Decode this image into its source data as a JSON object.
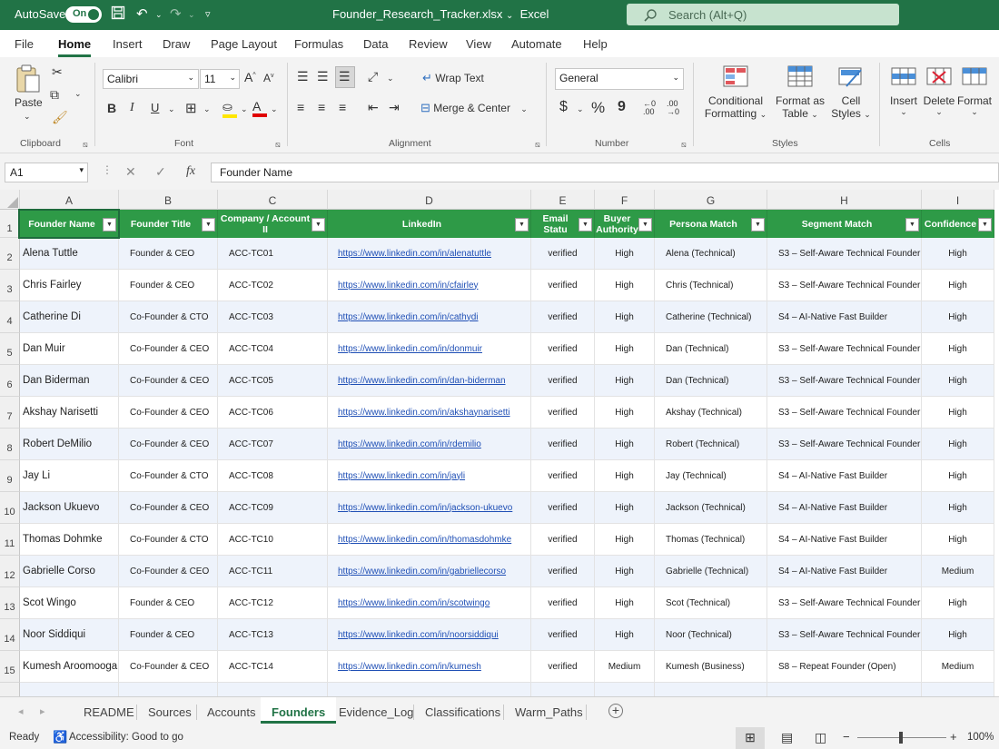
{
  "titlebar": {
    "autosave_label": "AutoSave",
    "autosave_state": "On",
    "doc_title": "Founder_Research_Tracker.xlsx",
    "app_name": "Excel",
    "search_placeholder": "Search (Alt+Q)",
    "color": "#217346"
  },
  "menu": [
    "File",
    "Home",
    "Insert",
    "Draw",
    "Page Layout",
    "Formulas",
    "Data",
    "Review",
    "View",
    "Automate",
    "Help"
  ],
  "ribbon": {
    "clipboard": {
      "paste": "Paste",
      "label": "Clipboard"
    },
    "font": {
      "name": "Calibri",
      "size": "11",
      "label": "Font",
      "bold": "B",
      "italic": "I",
      "underline": "U"
    },
    "alignment": {
      "wrap": "Wrap Text",
      "merge": "Merge & Center",
      "label": "Alignment"
    },
    "number": {
      "format": "General",
      "currency": "$",
      "percent": "%",
      "comma": "9",
      "label": "Number"
    },
    "styles": {
      "cond1": "Conditional",
      "cond2": "Formatting",
      "fmt1": "Format as",
      "fmt2": "Table",
      "cell1": "Cell",
      "cell2": "Styles",
      "label": "Styles"
    },
    "cells": {
      "insert": "Insert",
      "delete": "Delete",
      "format": "Format",
      "label": "Cells"
    }
  },
  "formula_bar": {
    "name_box": "A1",
    "fx": "fx",
    "content": "Founder Name"
  },
  "columns": [
    "A",
    "B",
    "C",
    "D",
    "E",
    "F",
    "G",
    "H",
    "I"
  ],
  "headers": [
    "Founder Name",
    "Founder Title",
    "Company / Account ID",
    "LinkedIn",
    "Email Status",
    "Buyer Authority",
    "Persona Match",
    "Segment Match",
    "Confidence"
  ],
  "header_display": [
    "Founder Name",
    "Founder Title",
    "Company / Account II",
    "LinkedIn",
    "Email Statu",
    "Buyer Authority",
    "Persona Match",
    "Segment Match",
    "Confidence"
  ],
  "rows": [
    {
      "n": "2",
      "name": "Alena Tuttle",
      "title": "Founder & CEO",
      "acc": "ACC-TC01",
      "li": "https://www.linkedin.com/in/alenatuttle",
      "email": "verified",
      "auth": "High",
      "persona": "Alena (Technical)",
      "segment": "S3 – Self-Aware Technical Founder",
      "conf": "High"
    },
    {
      "n": "3",
      "name": "Chris Fairley",
      "title": "Founder & CEO",
      "acc": "ACC-TC02",
      "li": "https://www.linkedin.com/in/cfairley",
      "email": "verified",
      "auth": "High",
      "persona": "Chris (Technical)",
      "segment": "S3 – Self-Aware Technical Founder",
      "conf": "High"
    },
    {
      "n": "4",
      "name": "Catherine Di",
      "title": "Co-Founder & CTO",
      "acc": "ACC-TC03",
      "li": "https://www.linkedin.com/in/cathydi",
      "email": "verified",
      "auth": "High",
      "persona": "Catherine (Technical)",
      "segment": "S4 – AI-Native Fast Builder",
      "conf": "High"
    },
    {
      "n": "5",
      "name": "Dan Muir",
      "title": "Co-Founder & CEO",
      "acc": "ACC-TC04",
      "li": "https://www.linkedin.com/in/donmuir",
      "email": "verified",
      "auth": "High",
      "persona": "Dan (Technical)",
      "segment": "S3 – Self-Aware Technical Founder",
      "conf": "High"
    },
    {
      "n": "6",
      "name": "Dan Biderman",
      "title": "Co-Founder & CEO",
      "acc": "ACC-TC05",
      "li": "https://www.linkedin.com/in/dan-biderman",
      "email": "verified",
      "auth": "High",
      "persona": "Dan (Technical)",
      "segment": "S3 – Self-Aware Technical Founder",
      "conf": "High"
    },
    {
      "n": "7",
      "name": "Akshay Narisetti",
      "title": "Co-Founder & CEO",
      "acc": "ACC-TC06",
      "li": "https://www.linkedin.com/in/akshaynarisetti",
      "email": "verified",
      "auth": "High",
      "persona": "Akshay (Technical)",
      "segment": "S3 – Self-Aware Technical Founder",
      "conf": "High"
    },
    {
      "n": "8",
      "name": "Robert DeMilio",
      "title": "Co-Founder & CEO",
      "acc": "ACC-TC07",
      "li": "https://www.linkedin.com/in/rdemilio",
      "email": "verified",
      "auth": "High",
      "persona": "Robert (Technical)",
      "segment": "S3 – Self-Aware Technical Founder",
      "conf": "High"
    },
    {
      "n": "9",
      "name": "Jay Li",
      "title": "Co-Founder & CTO",
      "acc": "ACC-TC08",
      "li": "https://www.linkedin.com/in/jayli",
      "email": "verified",
      "auth": "High",
      "persona": "Jay (Technical)",
      "segment": "S4 – AI-Native Fast Builder",
      "conf": "High"
    },
    {
      "n": "10",
      "name": "Jackson Ukuevo",
      "title": "Co-Founder & CEO",
      "acc": "ACC-TC09",
      "li": "https://www.linkedin.com/in/jackson-ukuevo",
      "email": "verified",
      "auth": "High",
      "persona": "Jackson (Technical)",
      "segment": "S4 – AI-Native Fast Builder",
      "conf": "High"
    },
    {
      "n": "11",
      "name": "Thomas Dohmke",
      "title": "Co-Founder & CTO",
      "acc": "ACC-TC10",
      "li": "https://www.linkedin.com/in/thomasdohmke",
      "email": "verified",
      "auth": "High",
      "persona": "Thomas (Technical)",
      "segment": "S4 – AI-Native Fast Builder",
      "conf": "High"
    },
    {
      "n": "12",
      "name": "Gabrielle Corso",
      "title": "Co-Founder & CEO",
      "acc": "ACC-TC11",
      "li": "https://www.linkedin.com/in/gabriellecorso",
      "email": "verified",
      "auth": "High",
      "persona": "Gabrielle (Technical)",
      "segment": "S4 – AI-Native Fast Builder",
      "conf": "Medium"
    },
    {
      "n": "13",
      "name": "Scot Wingo",
      "title": "Founder & CEO",
      "acc": "ACC-TC12",
      "li": "https://www.linkedin.com/in/scotwingo",
      "email": "verified",
      "auth": "High",
      "persona": "Scot (Technical)",
      "segment": "S3 – Self-Aware Technical Founder",
      "conf": "High"
    },
    {
      "n": "14",
      "name": "Noor Siddiqui",
      "title": "Founder & CEO",
      "acc": "ACC-TC13",
      "li": "https://www.linkedin.com/in/noorsiddiqui",
      "email": "verified",
      "auth": "High",
      "persona": "Noor (Technical)",
      "segment": "S3 – Self-Aware Technical Founder",
      "conf": "High"
    },
    {
      "n": "15",
      "name": "Kumesh Aroomoogan",
      "title": "Co-Founder & CEO",
      "acc": "ACC-TC14",
      "li": "https://www.linkedin.com/in/kumesh",
      "email": "verified",
      "auth": "Medium",
      "persona": "Kumesh (Business)",
      "segment": "S8 – Repeat Founder (Open)",
      "conf": "Medium"
    }
  ],
  "sheet_tabs": [
    "README",
    "Sources",
    "Accounts",
    "Founders",
    "Evidence_Log",
    "Classifications",
    "Warm_Paths"
  ],
  "active_tab": "Founders",
  "status": {
    "ready": "Ready",
    "accessibility": "Accessibility: Good to go",
    "zoom": "100%"
  },
  "colors": {
    "header_green": "#2e9a47",
    "stripe": "#eef3fb",
    "link": "#1f4fb5"
  }
}
